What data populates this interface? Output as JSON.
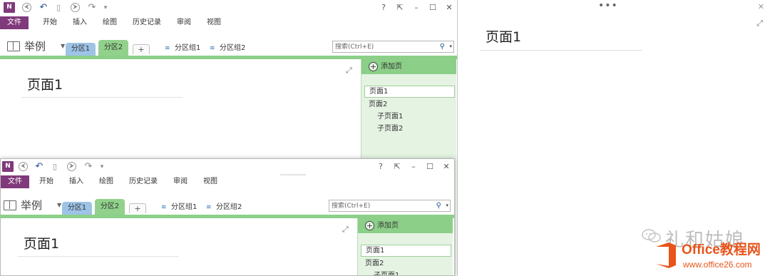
{
  "onenote": {
    "logo": "N",
    "title_icons": {
      "back": "⮜",
      "undo": "↶",
      "dock": "▯",
      "forward": "⮞",
      "redo": "↷",
      "customize": "▾"
    },
    "window_controls": {
      "help": "?",
      "fullscreen": "⇱",
      "minimize": "–",
      "maximize": "☐",
      "close": "✕"
    },
    "menu": {
      "file": "文件",
      "items": [
        "开始",
        "插入",
        "绘图",
        "历史记录",
        "审阅",
        "视图"
      ]
    },
    "notebook": {
      "name": "举例",
      "caret": "▼",
      "sections": [
        "分区1",
        "分区2"
      ],
      "add_section": "+",
      "section_groups": [
        "分区组1",
        "分区组2"
      ]
    },
    "search": {
      "placeholder": "搜索(Ctrl+E)",
      "icon": "⚲",
      "dropdown": "▾"
    },
    "canvas": {
      "expand_icon": "⤢",
      "page_title": "页面1"
    },
    "page_pane": {
      "add_page_icon": "+",
      "add_page": "添加页",
      "pages": [
        {
          "label": "页面1",
          "level": 0,
          "selected": true
        },
        {
          "label": "页面2",
          "level": 0,
          "selected": false
        },
        {
          "label": "子页面1",
          "level": 1,
          "selected": false
        },
        {
          "label": "子页面2",
          "level": 1,
          "selected": false
        }
      ]
    }
  },
  "right_pane": {
    "dots": "•••",
    "close": "✕",
    "expand": "⤢",
    "page_title": "页面1"
  },
  "watermark": {
    "name": "礼和姑娘",
    "brand": "Office教程网",
    "url": "www.office26.com"
  },
  "colors": {
    "onenote_purple": "#80397b",
    "section1_blue": "#9dc3e6",
    "section2_green": "#91d18b",
    "page_pane_bg": "#e5f3e3",
    "office_orange": "#e8541a"
  }
}
